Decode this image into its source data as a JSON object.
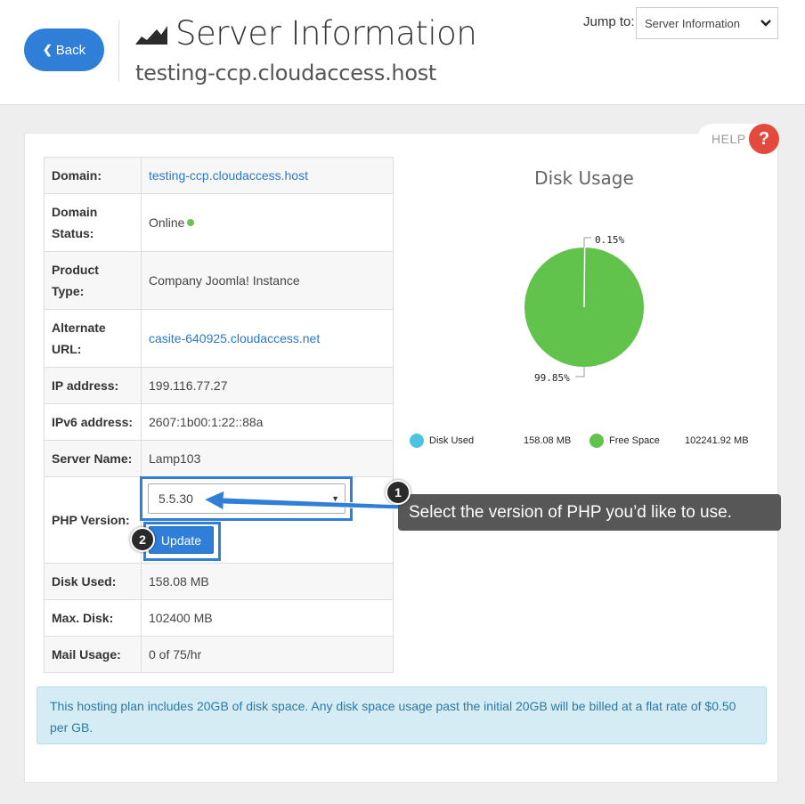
{
  "header": {
    "back_label": "Back",
    "title": "Server Information",
    "subtitle": "testing-ccp.cloudaccess.host",
    "jump_label": "Jump to:",
    "jump_value": "Server Information"
  },
  "help": {
    "label": "HELP",
    "symbol": "?"
  },
  "info": {
    "rows": [
      {
        "key": "Domain:",
        "value": "testing-ccp.cloudaccess.host"
      },
      {
        "key": "Domain Status:",
        "value": "Online"
      },
      {
        "key": "Product Type:",
        "value": "Company Joomla! Instance"
      },
      {
        "key": "Alternate URL:",
        "value": "casite-640925.cloudaccess.net"
      },
      {
        "key": "IP address:",
        "value": "199.116.77.27"
      },
      {
        "key": "IPv6 address:",
        "value": "2607:1b00:1:22::88a"
      },
      {
        "key": "Server Name:",
        "value": "Lamp103"
      },
      {
        "key": "PHP Version:",
        "value": "5.5.30"
      },
      {
        "key": "Disk Used:",
        "value": "158.08 MB"
      },
      {
        "key": "Max. Disk:",
        "value": "102400 MB"
      },
      {
        "key": "Mail Usage:",
        "value": "0 of 75/hr"
      }
    ],
    "update_label": "Update",
    "status_color": "#6cc24a"
  },
  "chart_data": {
    "type": "pie",
    "title": "Disk Usage",
    "series": [
      {
        "name": "Disk Used",
        "value": 158.08,
        "value_label": "158.08 MB",
        "percent_label": "0.15%",
        "color": "#4cc3e0"
      },
      {
        "name": "Free Space",
        "value": 102241.92,
        "value_label": "102241.92 MB",
        "percent_label": "99.85%",
        "color": "#61c24c"
      }
    ],
    "legend_position": "bottom"
  },
  "notice": "This hosting plan includes 20GB of disk space. Any disk space usage past the initial 20GB will be billed at a flat rate of $0.50 per GB.",
  "annotations": {
    "step1": "1",
    "step2": "2",
    "tooltip": "Select the version of PHP you’d like to use."
  },
  "icons": {
    "title": "area-chart-icon",
    "back": "chevron-left-icon",
    "jump": "chevron-down-icon"
  },
  "colors": {
    "primary": "#2f7fd8",
    "help": "#e34a3b",
    "link": "#2a78c8",
    "notice_bg": "#d5ecf5"
  }
}
